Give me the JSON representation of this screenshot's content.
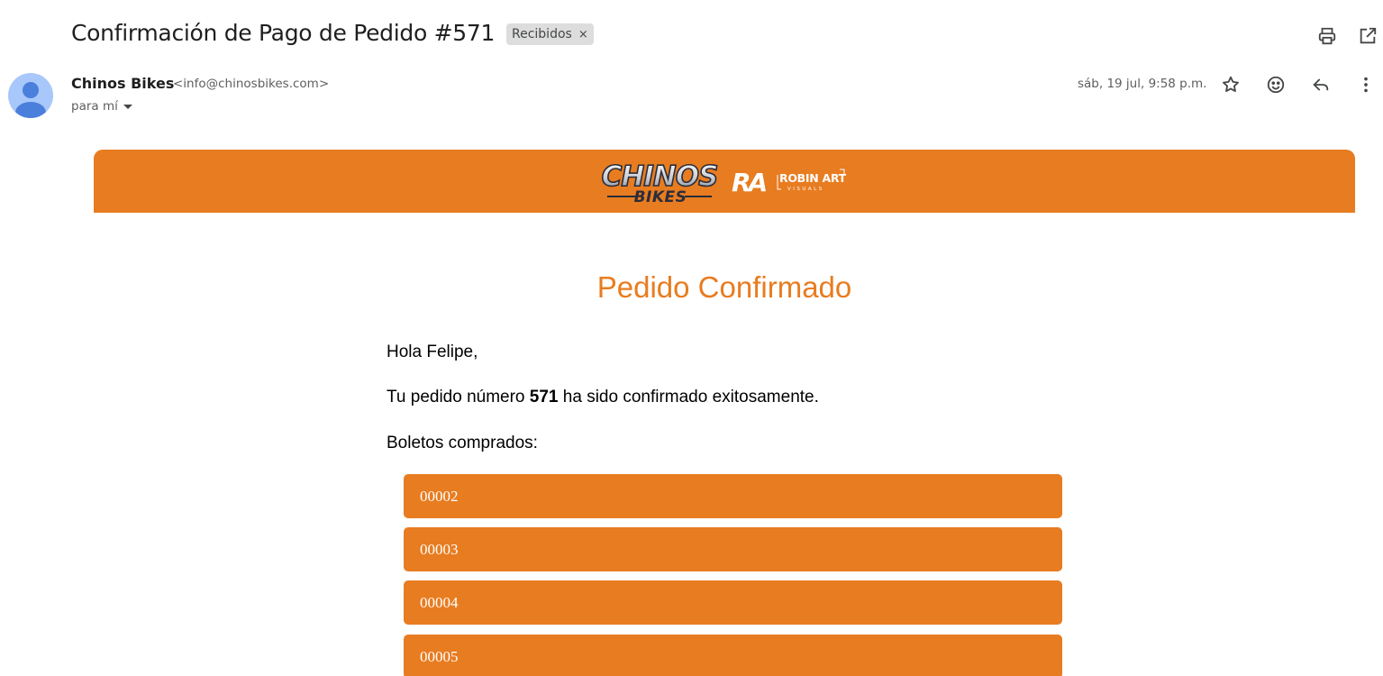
{
  "email": {
    "subject": "Confirmación de Pago de Pedido #571",
    "label": "Recibidos",
    "label_remove": "×",
    "sender_name": "Chinos Bikes",
    "sender_email": "<info@chinosbikes.com>",
    "recipient": "para mí",
    "date": "sáb, 19 jul, 9:58 p.m."
  },
  "icons": {
    "print": "print-icon",
    "open_new_window": "open-in-new-icon",
    "star": "star-icon",
    "emoji": "emoji-icon",
    "reply": "reply-icon",
    "more": "more-vert-icon",
    "avatar": "person-icon"
  },
  "body": {
    "brand_logo": "CHINOS BIKES",
    "partner_logo": "ROBIN ART VISUALS",
    "heading": "Pedido Confirmado",
    "greeting": "Hola Felipe,",
    "order_text_before": "Tu pedido número ",
    "order_number": "571",
    "order_text_after": " ha sido confirmado exitosamente.",
    "tickets_label": "Boletos comprados:",
    "tickets": [
      "00002",
      "00003",
      "00004",
      "00005"
    ]
  },
  "colors": {
    "brand_orange": "#e87c20",
    "avatar_bg": "#a8c7fa",
    "avatar_fg": "#4a7fdb",
    "chip_bg": "#dddddd"
  }
}
